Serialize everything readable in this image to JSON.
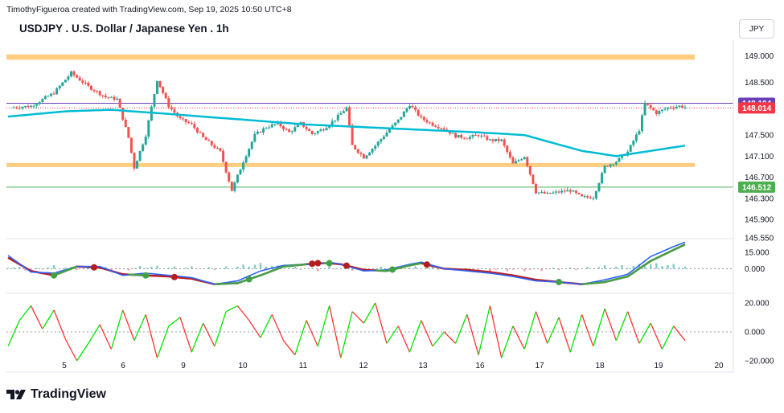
{
  "header": {
    "credit": "TimothyFigueroa created with TradingView.com, Sep 19, 2025 10:50 UTC+8"
  },
  "chart_title": "USDJPY . U.S. Dollar / Japanese Yen . 1h",
  "currency_button": "JPY",
  "brand": "TradingView",
  "colors": {
    "up": "#26a69a",
    "down": "#ef5350",
    "ma": "#00bcd4",
    "zone": "#ffcc80",
    "support": "#4caf50",
    "ask_tag": "#6a3fb5",
    "bid_tag": "#f23645",
    "macd_line": "#2962ff",
    "macd_signal": "#b71c1c",
    "rsi_up": "#00e600",
    "rsi_down": "#ff3333"
  },
  "chart_data": [
    {
      "type": "candlestick",
      "title": "USDJPY . U.S. Dollar / Japanese Yen . 1h",
      "x_ticks": [
        "5",
        "6",
        "9",
        "10",
        "11",
        "12",
        "13",
        "16",
        "17",
        "18",
        "19",
        "20"
      ],
      "y_ticks": [
        "149.000",
        "148.500",
        "147.500",
        "147.100",
        "146.700",
        "146.300",
        "145.900",
        "145.550"
      ],
      "ylim": [
        145.55,
        149.3
      ],
      "price_tags": [
        {
          "label": "148.104",
          "value": 148.104,
          "kind": "ask"
        },
        {
          "label": "148.014",
          "value": 148.014,
          "kind": "bid"
        },
        {
          "label": "146.512",
          "value": 146.512,
          "kind": "support"
        }
      ],
      "zones": [
        {
          "from": 148.93,
          "to": 149.03
        },
        {
          "from": 146.92,
          "to": 146.97
        }
      ],
      "close_path": [
        [
          0,
          148.02
        ],
        [
          4,
          148.05
        ],
        [
          8,
          148.3
        ],
        [
          11,
          148.68
        ],
        [
          14,
          148.42
        ],
        [
          17,
          148.22
        ],
        [
          19,
          148.18
        ],
        [
          21,
          147.45
        ],
        [
          22,
          146.88
        ],
        [
          24,
          147.5
        ],
        [
          26,
          148.55
        ],
        [
          28,
          148.05
        ],
        [
          30,
          147.8
        ],
        [
          32,
          147.7
        ],
        [
          34,
          147.45
        ],
        [
          37,
          147.18
        ],
        [
          39,
          146.45
        ],
        [
          41,
          147.0
        ],
        [
          43,
          147.5
        ],
        [
          45,
          147.65
        ],
        [
          47,
          147.72
        ],
        [
          49,
          147.55
        ],
        [
          51,
          147.72
        ],
        [
          53,
          147.52
        ],
        [
          55,
          147.62
        ],
        [
          57,
          147.8
        ],
        [
          59,
          148.02
        ],
        [
          60,
          147.3
        ],
        [
          62,
          147.08
        ],
        [
          64,
          147.3
        ],
        [
          66,
          147.55
        ],
        [
          68,
          147.78
        ],
        [
          70,
          148.08
        ],
        [
          72,
          147.82
        ],
        [
          74,
          147.7
        ],
        [
          76,
          147.62
        ],
        [
          78,
          147.48
        ],
        [
          80,
          147.45
        ],
        [
          82,
          147.5
        ],
        [
          84,
          147.4
        ],
        [
          86,
          147.4
        ],
        [
          88,
          146.95
        ],
        [
          90,
          147.1
        ],
        [
          92,
          146.42
        ],
        [
          94,
          146.38
        ],
        [
          96,
          146.42
        ],
        [
          98,
          146.45
        ],
        [
          100,
          146.32
        ],
        [
          102,
          146.32
        ],
        [
          104,
          146.9
        ],
        [
          106,
          147.0
        ],
        [
          108,
          147.18
        ],
        [
          110,
          147.6
        ],
        [
          111,
          148.1
        ],
        [
          113,
          147.92
        ],
        [
          115,
          148.02
        ],
        [
          117,
          148.05
        ],
        [
          118,
          148.03
        ]
      ],
      "moving_average": [
        [
          0,
          147.85
        ],
        [
          10,
          147.95
        ],
        [
          18,
          147.98
        ],
        [
          28,
          147.9
        ],
        [
          40,
          147.8
        ],
        [
          52,
          147.7
        ],
        [
          62,
          147.65
        ],
        [
          72,
          147.6
        ],
        [
          82,
          147.55
        ],
        [
          90,
          147.5
        ],
        [
          100,
          147.2
        ],
        [
          106,
          147.1
        ],
        [
          112,
          147.2
        ],
        [
          118,
          147.3
        ]
      ]
    },
    {
      "type": "macd",
      "y_ticks": [
        "15.000",
        "0.000"
      ],
      "ylim": [
        -20,
        25
      ],
      "macd": [
        [
          0,
          12
        ],
        [
          4,
          -3
        ],
        [
          8,
          -4
        ],
        [
          12,
          2
        ],
        [
          16,
          2
        ],
        [
          20,
          -6
        ],
        [
          24,
          -4
        ],
        [
          28,
          -6
        ],
        [
          32,
          -8
        ],
        [
          36,
          -14
        ],
        [
          40,
          -11
        ],
        [
          44,
          -2
        ],
        [
          48,
          3
        ],
        [
          52,
          4
        ],
        [
          54,
          4
        ],
        [
          56,
          6
        ],
        [
          58,
          4
        ],
        [
          62,
          -2
        ],
        [
          66,
          -1
        ],
        [
          70,
          4
        ],
        [
          72,
          6
        ],
        [
          76,
          0
        ],
        [
          80,
          -2
        ],
        [
          84,
          -4
        ],
        [
          88,
          -7
        ],
        [
          92,
          -11
        ],
        [
          96,
          -12
        ],
        [
          100,
          -14
        ],
        [
          104,
          -10
        ],
        [
          108,
          -5
        ],
        [
          110,
          3
        ],
        [
          112,
          11
        ],
        [
          116,
          20
        ],
        [
          118,
          24
        ]
      ],
      "signal": [
        [
          0,
          10
        ],
        [
          4,
          -2
        ],
        [
          8,
          -6
        ],
        [
          12,
          2
        ],
        [
          16,
          1
        ],
        [
          20,
          -5
        ],
        [
          24,
          -6
        ],
        [
          28,
          -7
        ],
        [
          32,
          -9
        ],
        [
          36,
          -14
        ],
        [
          40,
          -13
        ],
        [
          44,
          -6
        ],
        [
          48,
          2
        ],
        [
          52,
          4
        ],
        [
          54,
          5
        ],
        [
          56,
          5
        ],
        [
          58,
          4
        ],
        [
          62,
          -1
        ],
        [
          66,
          -2
        ],
        [
          70,
          3
        ],
        [
          72,
          5
        ],
        [
          76,
          0
        ],
        [
          80,
          -1
        ],
        [
          84,
          -3
        ],
        [
          88,
          -6
        ],
        [
          92,
          -10
        ],
        [
          96,
          -12
        ],
        [
          100,
          -14
        ],
        [
          104,
          -12
        ],
        [
          108,
          -7
        ],
        [
          110,
          0
        ],
        [
          112,
          7
        ],
        [
          116,
          17
        ],
        [
          118,
          22
        ]
      ],
      "cross_markers": [
        {
          "x": 8,
          "kind": "up"
        },
        {
          "x": 15,
          "kind": "down"
        },
        {
          "x": 24,
          "kind": "up"
        },
        {
          "x": 29,
          "kind": "down"
        },
        {
          "x": 42,
          "kind": "up"
        },
        {
          "x": 53,
          "kind": "down"
        },
        {
          "x": 54,
          "kind": "down"
        },
        {
          "x": 56,
          "kind": "up"
        },
        {
          "x": 59,
          "kind": "down"
        },
        {
          "x": 67,
          "kind": "up"
        },
        {
          "x": 73,
          "kind": "down"
        },
        {
          "x": 96,
          "kind": "up"
        }
      ]
    },
    {
      "type": "oscillator",
      "y_ticks": [
        "20.000",
        "0.000",
        "−20.000"
      ],
      "ylim": [
        -25,
        25
      ],
      "values": [
        [
          0,
          -10
        ],
        [
          2,
          8
        ],
        [
          4,
          18
        ],
        [
          6,
          2
        ],
        [
          8,
          15
        ],
        [
          10,
          -5
        ],
        [
          12,
          -20
        ],
        [
          14,
          -8
        ],
        [
          16,
          5
        ],
        [
          18,
          -12
        ],
        [
          20,
          15
        ],
        [
          22,
          -6
        ],
        [
          24,
          12
        ],
        [
          26,
          -18
        ],
        [
          28,
          4
        ],
        [
          30,
          10
        ],
        [
          32,
          -14
        ],
        [
          34,
          6
        ],
        [
          36,
          -10
        ],
        [
          38,
          14
        ],
        [
          40,
          18
        ],
        [
          42,
          8
        ],
        [
          44,
          -4
        ],
        [
          46,
          12
        ],
        [
          48,
          -6
        ],
        [
          50,
          -16
        ],
        [
          52,
          8
        ],
        [
          54,
          -10
        ],
        [
          56,
          18
        ],
        [
          58,
          -18
        ],
        [
          60,
          14
        ],
        [
          62,
          6
        ],
        [
          64,
          20
        ],
        [
          66,
          -8
        ],
        [
          68,
          4
        ],
        [
          70,
          -14
        ],
        [
          72,
          8
        ],
        [
          74,
          -10
        ],
        [
          76,
          0
        ],
        [
          78,
          -8
        ],
        [
          80,
          12
        ],
        [
          82,
          -16
        ],
        [
          84,
          18
        ],
        [
          86,
          -18
        ],
        [
          88,
          4
        ],
        [
          90,
          -12
        ],
        [
          92,
          14
        ],
        [
          94,
          -8
        ],
        [
          96,
          10
        ],
        [
          98,
          -14
        ],
        [
          100,
          12
        ],
        [
          102,
          -10
        ],
        [
          104,
          16
        ],
        [
          106,
          -6
        ],
        [
          108,
          14
        ],
        [
          110,
          -8
        ],
        [
          112,
          6
        ],
        [
          114,
          -12
        ],
        [
          116,
          4
        ],
        [
          118,
          -6
        ]
      ]
    }
  ]
}
